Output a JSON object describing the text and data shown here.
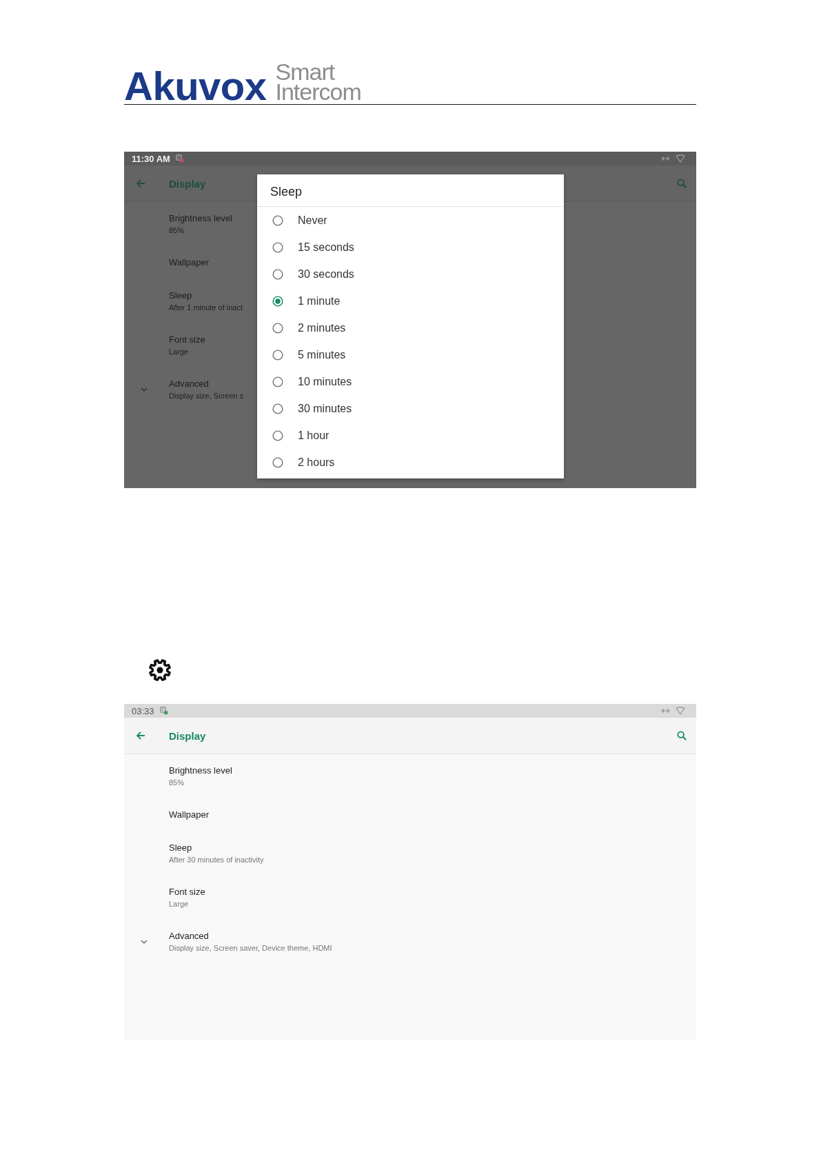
{
  "header": {
    "brand": "Akuvox",
    "tagline": [
      "Smart",
      "Intercom"
    ]
  },
  "screenshots": [
    {
      "status_bar": {
        "time": "11:30 AM",
        "notification": {
          "color": "#c9505e"
        }
      },
      "app_bar": {
        "title": "Display"
      },
      "settings": [
        {
          "title": "Brightness level",
          "summary": "85%"
        },
        {
          "title": "Wallpaper"
        },
        {
          "title": "Sleep",
          "summary": "After 1 minute of inact"
        },
        {
          "title": "Font size",
          "summary": "Large"
        }
      ],
      "advanced": {
        "title": "Advanced",
        "summary": "Display size, Screen s",
        "expanded": false
      },
      "dialog": {
        "title": "Sleep",
        "options": [
          {
            "label": "Never",
            "selected": false
          },
          {
            "label": "15 seconds",
            "selected": false
          },
          {
            "label": "30 seconds",
            "selected": false
          },
          {
            "label": "1 minute",
            "selected": true
          },
          {
            "label": "2 minutes",
            "selected": false
          },
          {
            "label": "5 minutes",
            "selected": false
          },
          {
            "label": "10 minutes",
            "selected": false
          },
          {
            "label": "30 minutes",
            "selected": false
          },
          {
            "label": "1 hour",
            "selected": false
          },
          {
            "label": "2 hours",
            "selected": false
          }
        ]
      }
    },
    {
      "status_bar": {
        "time": "03:33",
        "notification": {
          "color": "#3f9c5a"
        }
      },
      "app_bar": {
        "title": "Display"
      },
      "settings": [
        {
          "title": "Brightness level",
          "summary": "85%"
        },
        {
          "title": "Wallpaper"
        },
        {
          "title": "Sleep",
          "summary": "After 30 minutes of inactivity"
        },
        {
          "title": "Font size",
          "summary": "Large"
        }
      ],
      "advanced": {
        "title": "Advanced",
        "summary": "Display size, Screen saver, Device theme, HDMI",
        "expanded": false
      }
    }
  ]
}
